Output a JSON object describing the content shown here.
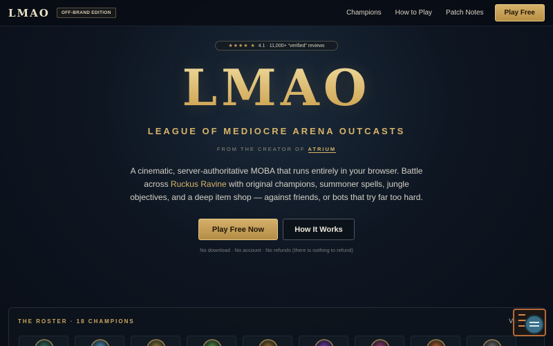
{
  "nav": {
    "brand": "LMAO",
    "edition": "OFF-BRAND EDITION",
    "links": [
      "Champions",
      "How to Play",
      "Patch Notes"
    ],
    "cta": "Play Free"
  },
  "hero": {
    "stars": "★★★★ ★",
    "rating_text": "4.1 · 11,000+ “verified” reviews",
    "title": "LMAO",
    "subtitle": "LEAGUE OF MEDIOCRE ARENA OUTCASTS",
    "creator_prefix": "FROM THE CREATOR OF",
    "creator_name": "ATRIUM",
    "desc_part1": "A cinematic, server-authoritative MOBA that runs entirely in your browser. Battle across ",
    "desc_highlight": "Ruckus Ravine",
    "desc_part2": " with original champions, summoner spells, jungle objectives, and a deep item shop — against friends, or bots that try far too hard.",
    "primary_button": "Play Free Now",
    "secondary_button": "How It Works",
    "fineprint": "No download · No account · No refunds (there is nothing to refund)"
  },
  "roster": {
    "title": "THE ROSTER · 18 CHAMPIONS",
    "view_link": "View all",
    "cards": [
      {
        "color": "#2f6a5a"
      },
      {
        "color": "#4a8ab0"
      },
      {
        "color": "#8a7a3a"
      },
      {
        "color": "#4f8a3a"
      },
      {
        "color": "#8a6a2a"
      },
      {
        "color": "#6a3aa0"
      },
      {
        "color": "#8a3a6a"
      },
      {
        "color": "#b0602a"
      },
      {
        "color": "#6a6a6a"
      }
    ]
  },
  "colors": {
    "accent": "#d7b46a",
    "background": "#0e1622"
  }
}
